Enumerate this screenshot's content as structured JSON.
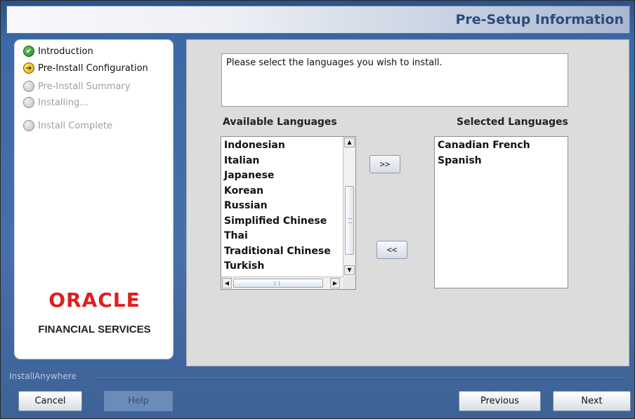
{
  "header": {
    "title": "Pre-Setup Information"
  },
  "steps": [
    {
      "label": "Introduction",
      "state": "done"
    },
    {
      "label": "Pre-Install Configuration",
      "state": "current"
    },
    {
      "label": "Pre-Install Summary",
      "state": "pending"
    },
    {
      "label": "Installing...",
      "state": "pending"
    },
    {
      "label": "Install Complete",
      "state": "pending"
    }
  ],
  "brand": {
    "logo_text": "ORACLE",
    "subtitle": "FINANCIAL SERVICES",
    "logo_color": "#e01e1e"
  },
  "content": {
    "instruction": "Please select the languages you wish to install.",
    "available_label": "Available Languages",
    "selected_label": "Selected Languages",
    "available_items": [
      "Indonesian",
      "Italian",
      "Japanese",
      "Korean",
      "Russian",
      "Simplified Chinese",
      "Thai",
      "Traditional Chinese",
      "Turkish"
    ],
    "selected_items": [
      "Canadian French",
      "Spanish"
    ],
    "add_button": ">>",
    "remove_button": "<<",
    "icons": {
      "scroll_up": "▲",
      "scroll_down": "▼",
      "scroll_left": "◀",
      "scroll_right": "▶",
      "done": "✔",
      "current": "➔"
    }
  },
  "footer": {
    "brand": "InstallAnywhere",
    "cancel": "Cancel",
    "help": "Help",
    "previous": "Previous",
    "next": "Next"
  }
}
